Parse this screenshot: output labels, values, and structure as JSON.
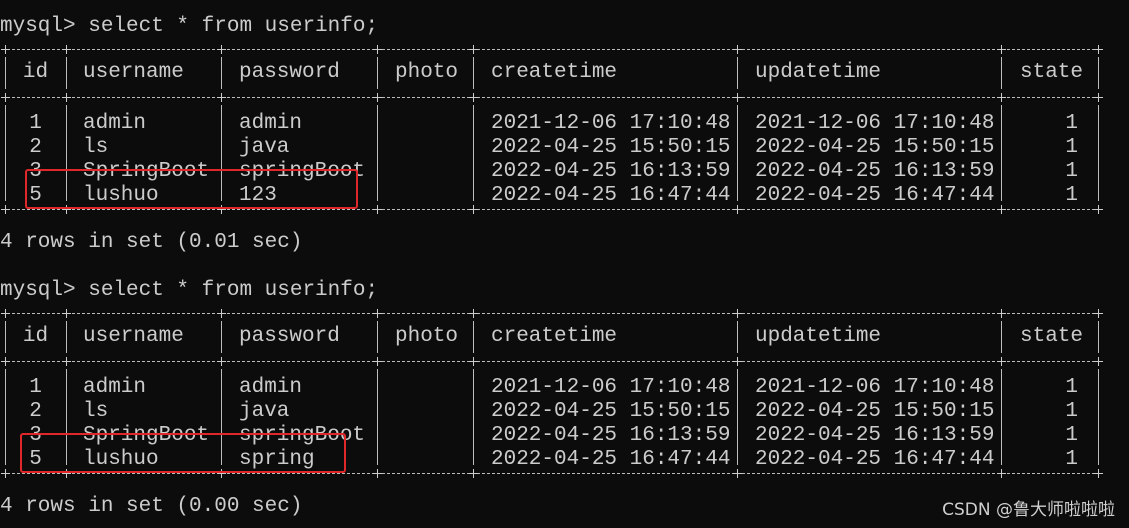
{
  "terminal": {
    "blocks": [
      {
        "command": "mysql> select * from userinfo;",
        "columns": [
          "id",
          "username",
          "password",
          "photo",
          "createtime",
          "updatetime",
          "state"
        ],
        "rows": [
          [
            "1",
            "admin",
            "admin",
            "",
            "2021-12-06 17:10:48",
            "2021-12-06 17:10:48",
            "1"
          ],
          [
            "2",
            "ls",
            "java",
            "",
            "2022-04-25 15:50:15",
            "2022-04-25 15:50:15",
            "1"
          ],
          [
            "3",
            "SpringBoot",
            "springBoot",
            "",
            "2022-04-25 16:13:59",
            "2022-04-25 16:13:59",
            "1"
          ],
          [
            "5",
            "lushuo",
            "123",
            "",
            "2022-04-25 16:47:44",
            "2022-04-25 16:47:44",
            "1"
          ]
        ],
        "summary": "4 rows in set (0.01 sec)",
        "highlighted_row": 3
      },
      {
        "command": "mysql> select * from userinfo;",
        "columns": [
          "id",
          "username",
          "password",
          "photo",
          "createtime",
          "updatetime",
          "state"
        ],
        "rows": [
          [
            "1",
            "admin",
            "admin",
            "",
            "2021-12-06 17:10:48",
            "2021-12-06 17:10:48",
            "1"
          ],
          [
            "2",
            "ls",
            "java",
            "",
            "2022-04-25 15:50:15",
            "2022-04-25 15:50:15",
            "1"
          ],
          [
            "3",
            "SpringBoot",
            "springBoot",
            "",
            "2022-04-25 16:13:59",
            "2022-04-25 16:13:59",
            "1"
          ],
          [
            "5",
            "lushuo",
            "spring",
            "",
            "2022-04-25 16:47:44",
            "2022-04-25 16:47:44",
            "1"
          ]
        ],
        "summary": "4 rows in set (0.00 sec)",
        "highlighted_row": 3
      }
    ]
  },
  "colors": {
    "background": "#0c0c0c",
    "text": "#cccccc",
    "highlight": "#e0282a"
  },
  "watermark": "CSDN @鲁大师啦啦啦"
}
